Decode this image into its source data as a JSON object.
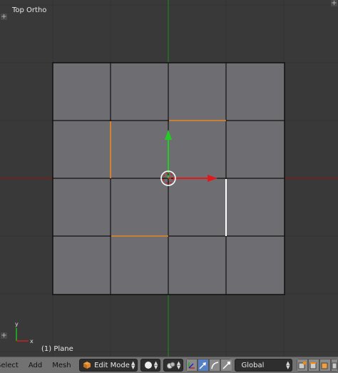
{
  "viewport": {
    "view_name": "Top Ortho",
    "object_label": "(1) Plane",
    "grid_color": "#393939",
    "plane_color": "#6e6e72",
    "edge_color": "#111111",
    "selected_edge_color": "#f08c2a",
    "active_edge_color": "#ffffff",
    "x_axis_color": "#9b1010",
    "y_axis_color": "#1f8c1f",
    "axis_icon_labels": {
      "x": "x",
      "y": "y"
    }
  },
  "header": {
    "menus": [
      "Select",
      "Add",
      "Mesh"
    ],
    "mode": "Edit Mode",
    "transform_orientation": "Global",
    "icons": {
      "mode": "cube-icon",
      "shading": "sphere-icon",
      "pivot": "pivot-icon",
      "manipulator": "manipulator-icon",
      "translate": "arrow-icon",
      "rotate": "rotate-icon",
      "scale": "scale-icon",
      "vertex_select": "vertex-select-icon",
      "edge_select": "edge-select-icon",
      "face_select": "face-select-icon",
      "occlude": "occlude-icon"
    }
  }
}
